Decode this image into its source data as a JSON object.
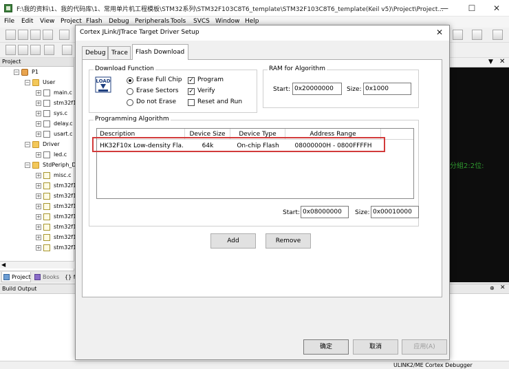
{
  "window": {
    "title": "F:\\我的资料\\1、我的代码库\\1、常用单片机工程模板\\STM32系列\\STM32F103C8T6_template\\STM32F103C8T6_template(Keil v5)\\Project\\Project..."
  },
  "menu": [
    "File",
    "Edit",
    "View",
    "Project",
    "Flash",
    "Debug",
    "Peripherals",
    "Tools",
    "SVCS",
    "Window",
    "Help"
  ],
  "project_pane": {
    "title": "Project",
    "tree": [
      {
        "label": "P1",
        "icon": "target-icon"
      },
      {
        "label": "User",
        "icon": "folder-icon"
      },
      {
        "label": "main.c",
        "icon": "file-icon"
      },
      {
        "label": "stm32f1",
        "icon": "file-icon"
      },
      {
        "label": "sys.c",
        "icon": "file-icon"
      },
      {
        "label": "delay.c",
        "icon": "file-icon"
      },
      {
        "label": "usart.c",
        "icon": "file-icon"
      },
      {
        "label": "Driver",
        "icon": "folder-icon"
      },
      {
        "label": "led.c",
        "icon": "file-icon"
      },
      {
        "label": "StdPeriph_D",
        "icon": "folder-icon"
      },
      {
        "label": "misc.c",
        "icon": "file-icon"
      },
      {
        "label": "stm32f1",
        "icon": "file-icon"
      },
      {
        "label": "stm32f1",
        "icon": "file-icon"
      },
      {
        "label": "stm32f1",
        "icon": "file-icon"
      },
      {
        "label": "stm32f1",
        "icon": "file-icon"
      },
      {
        "label": "stm32f1",
        "icon": "file-icon"
      },
      {
        "label": "stm32f1",
        "icon": "file-icon"
      },
      {
        "label": "stm32f1",
        "icon": "file-icon"
      }
    ],
    "tabs": [
      "Project",
      "Books",
      "{} f"
    ]
  },
  "editor": {
    "snippet": "分組2:2位:"
  },
  "build_output": {
    "title": "Build Output"
  },
  "status": {
    "debugger": "ULINK2/ME Cortex Debugger"
  },
  "dialog": {
    "title": "Cortex JLink/JTrace Target Driver Setup",
    "tabs": [
      "Debug",
      "Trace",
      "Flash Download"
    ],
    "active_tab": "Flash Download",
    "download_function": {
      "title": "Download Function",
      "icon_label": "LOAD",
      "erase_options": [
        "Erase Full Chip",
        "Erase Sectors",
        "Do not Erase"
      ],
      "erase_selected": "Erase Full Chip",
      "checkboxes": [
        {
          "label": "Program",
          "checked": true
        },
        {
          "label": "Verify",
          "checked": true
        },
        {
          "label": "Reset and Run",
          "checked": false
        }
      ]
    },
    "ram": {
      "title": "RAM for Algorithm",
      "start_label": "Start:",
      "start_value": "0x20000000",
      "size_label": "Size:",
      "size_value": "0x1000"
    },
    "programming_algorithm": {
      "title": "Programming Algorithm",
      "columns": [
        "Description",
        "Device Size",
        "Device Type",
        "Address Range"
      ],
      "rows": [
        [
          "HK32F10x Low-density Fla...",
          "64k",
          "On-chip Flash",
          "08000000H - 0800FFFFH"
        ]
      ],
      "start_label": "Start:",
      "start_value": "0x08000000",
      "size_label": "Size:",
      "size_value": "0x00010000"
    },
    "add_label": "Add",
    "remove_label": "Remove",
    "ok_label": "确定",
    "cancel_label": "取消",
    "apply_label": "应用(A)"
  }
}
